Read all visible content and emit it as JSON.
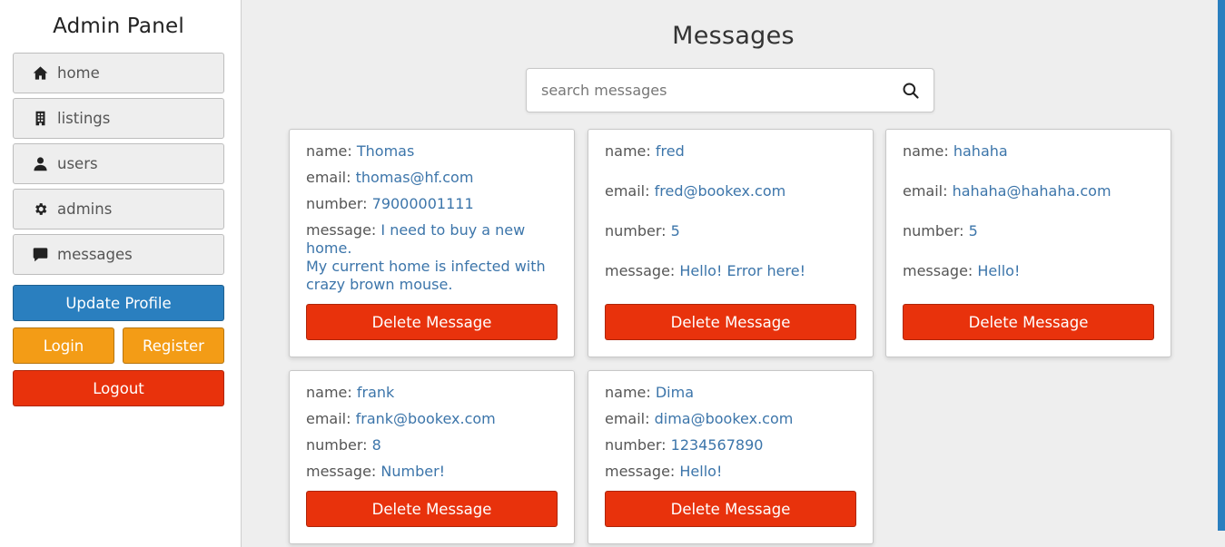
{
  "sidebar": {
    "title": "Admin Panel",
    "items": [
      {
        "label": "home",
        "icon": "home-icon"
      },
      {
        "label": "listings",
        "icon": "building-icon"
      },
      {
        "label": "users",
        "icon": "user-icon"
      },
      {
        "label": "admins",
        "icon": "gear-icon"
      },
      {
        "label": "messages",
        "icon": "comment-icon"
      }
    ],
    "update_profile": "Update Profile",
    "login": "Login",
    "register": "Register",
    "logout": "Logout"
  },
  "main": {
    "title": "Messages",
    "search": {
      "placeholder": "search messages",
      "value": ""
    }
  },
  "labels": {
    "name": "name: ",
    "email": "email: ",
    "number": "number: ",
    "message": "message: ",
    "delete": "Delete Message"
  },
  "messages": [
    {
      "name": "Thomas",
      "email": "thomas@hf.com",
      "number": "79000001111",
      "message_line1": "I need to buy a new",
      "message_line2": "home.",
      "message_line3": "My current home is infected with",
      "message_line4": "crazy brown mouse."
    },
    {
      "name": "fred",
      "email": "fred@bookex.com",
      "number": "5",
      "message": "Hello! Error here!"
    },
    {
      "name": "hahaha",
      "email": "hahaha@hahaha.com",
      "number": "5",
      "message": "Hello!"
    },
    {
      "name": "frank",
      "email": "frank@bookex.com",
      "number": "8",
      "message": "Number!"
    },
    {
      "name": "Dima",
      "email": "dima@bookex.com",
      "number": "1234567890",
      "message": "Hello!"
    }
  ],
  "colors": {
    "primary": "#2a7fbf",
    "warning": "#f39c16",
    "danger": "#e8320c",
    "value_text": "#3c75aa"
  }
}
